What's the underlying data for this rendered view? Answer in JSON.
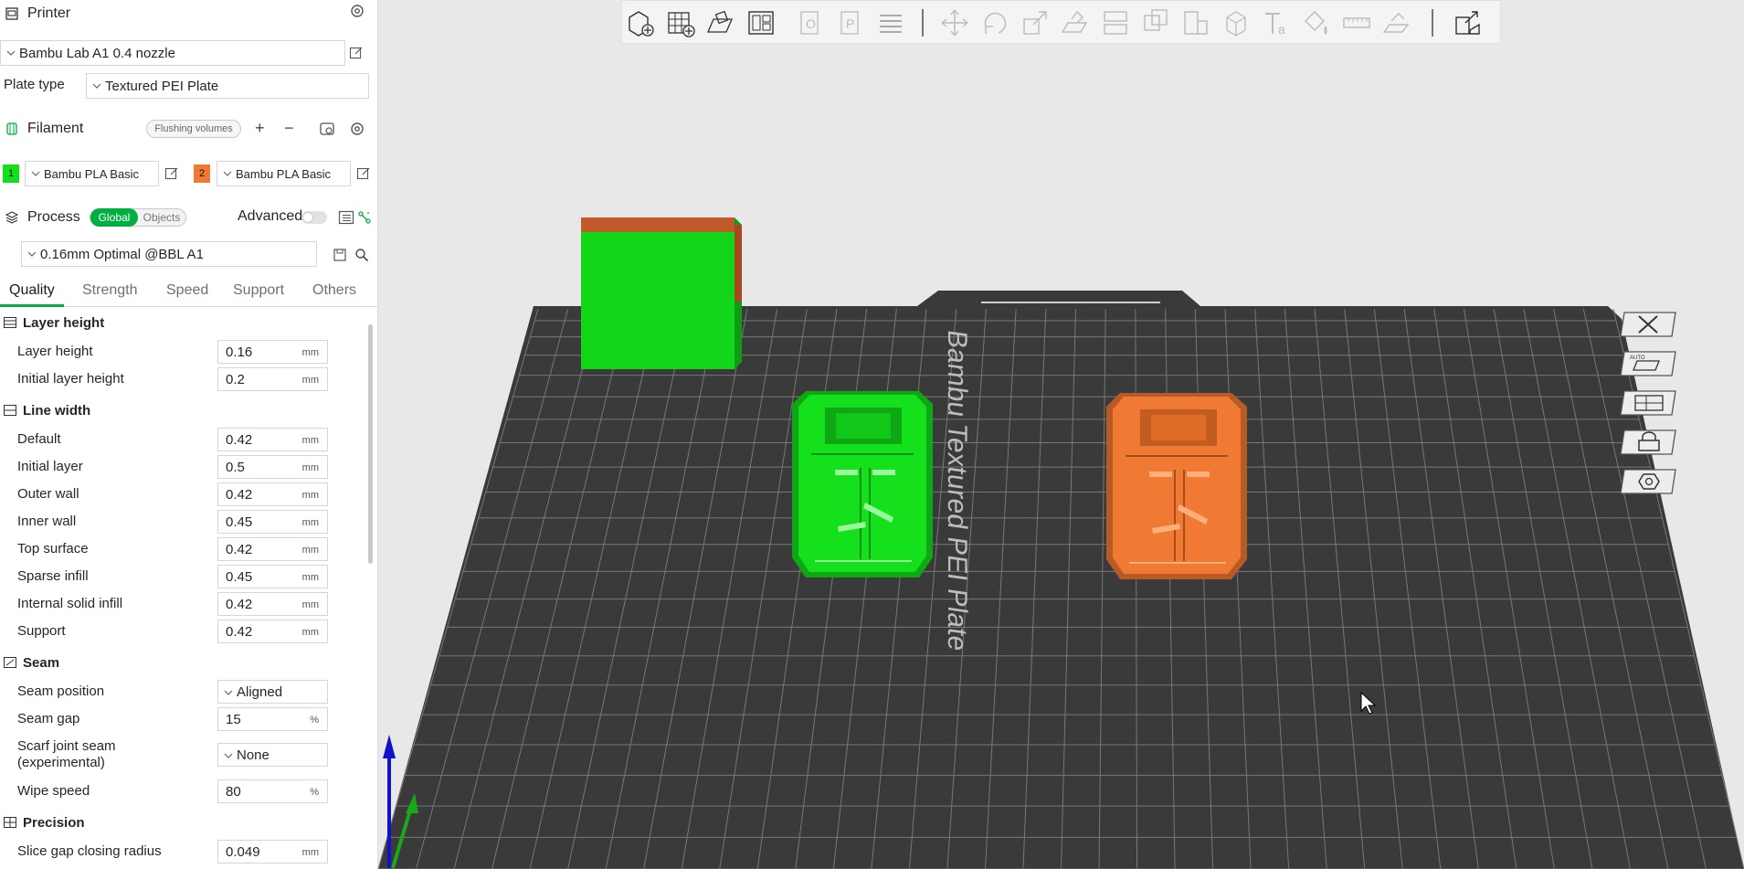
{
  "printer": {
    "title": "Printer",
    "preset": "Bambu Lab A1 0.4 nozzle",
    "plate_type_label": "Plate type",
    "plate_type": "Textured PEI Plate"
  },
  "filament": {
    "title": "Filament",
    "flushing_label": "Flushing volumes",
    "plus": "+",
    "minus": "−",
    "slots": [
      {
        "index": "1",
        "color": "#12e01a",
        "name": "Bambu PLA Basic"
      },
      {
        "index": "2",
        "color": "#f07a33",
        "name": "Bambu PLA Basic"
      }
    ]
  },
  "process": {
    "title": "Process",
    "global_label": "Global",
    "objects_label": "Objects",
    "advanced_label": "Advanced",
    "preset": "0.16mm Optimal @BBL A1"
  },
  "tabs": [
    "Quality",
    "Strength",
    "Speed",
    "Support",
    "Others"
  ],
  "active_tab": "Quality",
  "groups": {
    "layer_height": {
      "title": "Layer height",
      "rows": [
        {
          "label": "Layer height",
          "value": "0.16",
          "unit": "mm"
        },
        {
          "label": "Initial layer height",
          "value": "0.2",
          "unit": "mm"
        }
      ]
    },
    "line_width": {
      "title": "Line width",
      "rows": [
        {
          "label": "Default",
          "value": "0.42",
          "unit": "mm"
        },
        {
          "label": "Initial layer",
          "value": "0.5",
          "unit": "mm"
        },
        {
          "label": "Outer wall",
          "value": "0.42",
          "unit": "mm"
        },
        {
          "label": "Inner wall",
          "value": "0.45",
          "unit": "mm"
        },
        {
          "label": "Top surface",
          "value": "0.42",
          "unit": "mm"
        },
        {
          "label": "Sparse infill",
          "value": "0.45",
          "unit": "mm"
        },
        {
          "label": "Internal solid infill",
          "value": "0.42",
          "unit": "mm"
        },
        {
          "label": "Support",
          "value": "0.42",
          "unit": "mm"
        }
      ]
    },
    "seam": {
      "title": "Seam",
      "rows": [
        {
          "label": "Seam position",
          "value": "Aligned"
        },
        {
          "label": "Seam gap",
          "value": "15",
          "unit": "%"
        },
        {
          "label": "Scarf joint seam",
          "label2": "(experimental)",
          "value": "None"
        },
        {
          "label": "Wipe speed",
          "value": "80",
          "unit": "%"
        }
      ]
    },
    "precision": {
      "title": "Precision",
      "rows": [
        {
          "label": "Slice gap closing radius",
          "value": "0.049",
          "unit": "mm"
        }
      ]
    }
  },
  "viewport": {
    "plate_text": "Bambu Textured PEI Plate",
    "colors": {
      "plate": "#3a3a3a",
      "grid": "#7a7a7a",
      "green": "#12e01a",
      "orange": "#f07a33"
    }
  }
}
